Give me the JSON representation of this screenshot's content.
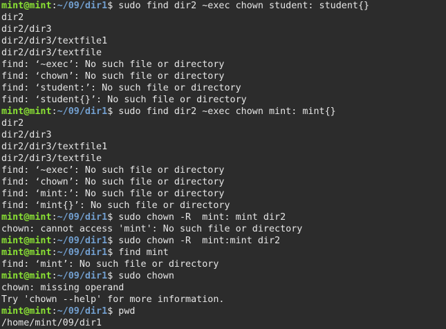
{
  "colors": {
    "background": "#2c2c2c",
    "text": "#e6e6e6",
    "user": "#8ae234",
    "path": "#729fcf"
  },
  "prompt": {
    "user_host": "mint@mint",
    "colon": ":",
    "cwd": "~/09/dir1",
    "symbol": "$"
  },
  "lines": [
    {
      "type": "prompt",
      "command": " sudo find dir2 ~exec chown student: student{}"
    },
    {
      "type": "output",
      "text": "dir2"
    },
    {
      "type": "output",
      "text": "dir2/dir3"
    },
    {
      "type": "output",
      "text": "dir2/dir3/textfile1"
    },
    {
      "type": "output",
      "text": "dir2/dir3/textfile"
    },
    {
      "type": "output",
      "text": "find: ‘~exec’: No such file or directory"
    },
    {
      "type": "output",
      "text": "find: ‘chown’: No such file or directory"
    },
    {
      "type": "output",
      "text": "find: ‘student:’: No such file or directory"
    },
    {
      "type": "output",
      "text": "find: ‘student{}’: No such file or directory"
    },
    {
      "type": "prompt",
      "command": " sudo find dir2 ~exec chown mint: mint{}"
    },
    {
      "type": "output",
      "text": "dir2"
    },
    {
      "type": "output",
      "text": "dir2/dir3"
    },
    {
      "type": "output",
      "text": "dir2/dir3/textfile1"
    },
    {
      "type": "output",
      "text": "dir2/dir3/textfile"
    },
    {
      "type": "output",
      "text": "find: ‘~exec’: No such file or directory"
    },
    {
      "type": "output",
      "text": "find: ‘chown’: No such file or directory"
    },
    {
      "type": "output",
      "text": "find: ‘mint:’: No such file or directory"
    },
    {
      "type": "output",
      "text": "find: ‘mint{}’: No such file or directory"
    },
    {
      "type": "prompt",
      "command": " sudo chown -R  mint: mint dir2"
    },
    {
      "type": "output",
      "text": "chown: cannot access 'mint': No such file or directory"
    },
    {
      "type": "prompt",
      "command": " sudo chown -R  mint:mint dir2"
    },
    {
      "type": "prompt",
      "command": " find mint"
    },
    {
      "type": "output",
      "text": "find: ‘mint’: No such file or directory"
    },
    {
      "type": "prompt",
      "command": " sudo chown"
    },
    {
      "type": "output",
      "text": "chown: missing operand"
    },
    {
      "type": "output",
      "text": "Try 'chown --help' for more information."
    },
    {
      "type": "prompt",
      "command": " pwd"
    },
    {
      "type": "output",
      "text": "/home/mint/09/dir1"
    }
  ]
}
